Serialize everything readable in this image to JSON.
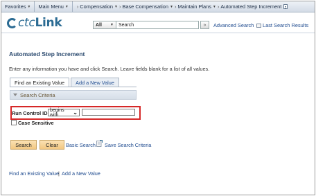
{
  "nav": {
    "favorites": "Favorites",
    "main_menu": "Main Menu",
    "breadcrumbs": [
      "Compensation",
      "Base Compensation",
      "Maintain Plans",
      "Automated Step Increment"
    ]
  },
  "header": {
    "logo_prefix": "",
    "logo_ctc": "ctc",
    "logo_link": "Link",
    "search_scope": "All",
    "search_value": "Search",
    "advanced_search": "Advanced Search",
    "last_search_results": "Last Search Results"
  },
  "page": {
    "title": "Automated Step Increment",
    "instructions": "Enter any information you have and click Search. Leave fields blank for a list of all values.",
    "tabs": [
      "Find an Existing Value",
      "Add a New Value"
    ],
    "criteria_header": "Search Criteria",
    "run_control_label": "Run Control ID:",
    "operator": "begins with",
    "run_control_value": "",
    "case_sensitive_label": "Case Sensitive",
    "search_button": "Search",
    "clear_button": "Clear",
    "basic_search": "Basic Search",
    "save_search_criteria": "Save Search Criteria",
    "footer_find": "Find an Existing Value",
    "footer_separator": "|",
    "footer_add": "Add a New Value"
  },
  "colors": {
    "link": "#1f4b8f",
    "logo": "#2b6b93",
    "highlight": "#d62727",
    "button": "#f2c782"
  }
}
